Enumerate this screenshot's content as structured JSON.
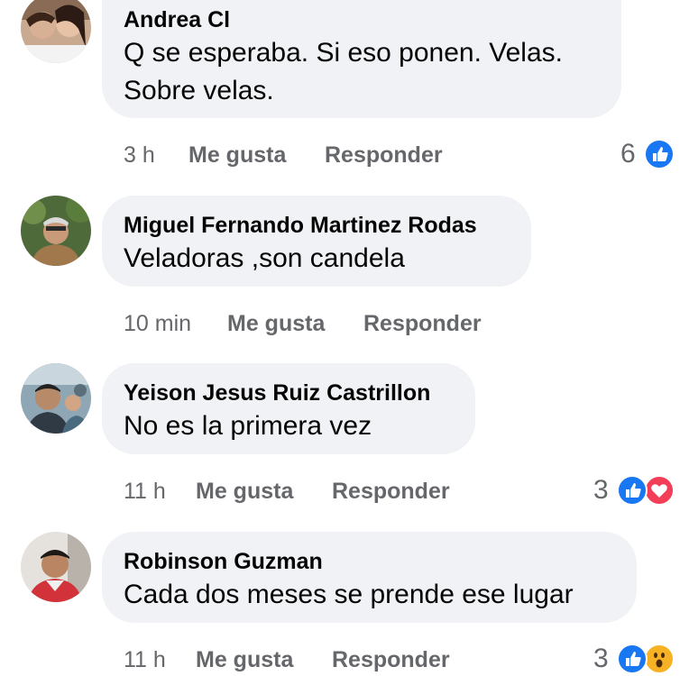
{
  "comments": [
    {
      "author": "Andrea Cl",
      "text_lines": [
        "Q se esperaba. Si eso ponen. Velas.",
        "Sobre velas."
      ],
      "time": "3 h",
      "like_label": "Me gusta",
      "reply_label": "Responder",
      "reaction_count": "6",
      "reactions": [
        "like-icon"
      ]
    },
    {
      "author": "Miguel Fernando Martinez Rodas",
      "text_lines": [
        "Veladoras ,son candela"
      ],
      "time": "10 min",
      "like_label": "Me gusta",
      "reply_label": "Responder",
      "reaction_count": "",
      "reactions": []
    },
    {
      "author": "Yeison Jesus Ruiz Castrillon",
      "text_lines": [
        "No es la primera vez"
      ],
      "time": "11 h",
      "like_label": "Me gusta",
      "reply_label": "Responder",
      "reaction_count": "3",
      "reactions": [
        "like-icon",
        "love-icon"
      ]
    },
    {
      "author": "Robinson Guzman",
      "text_lines": [
        "Cada dos meses se prende ese lugar"
      ],
      "time": "11 h",
      "like_label": "Me gusta",
      "reply_label": "Responder",
      "reaction_count": "3",
      "reactions": [
        "like-icon",
        "wow-icon"
      ]
    }
  ],
  "colors": {
    "bubble": "#f0f2f5",
    "meta_text": "#65676b",
    "like_blue": "#1877f2",
    "love_red": "#f33e58",
    "wow_yellow": "#f7b125"
  }
}
